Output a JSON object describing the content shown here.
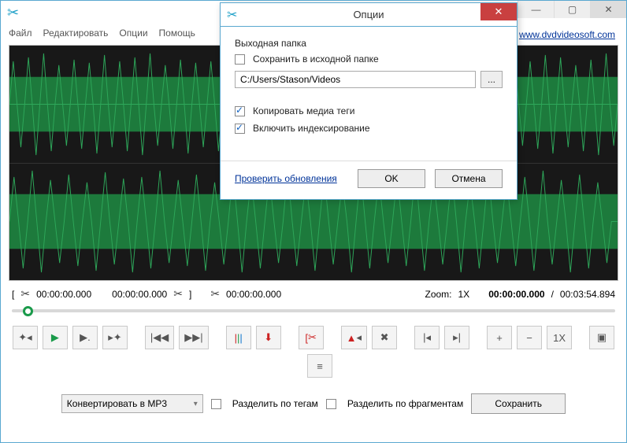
{
  "menubar": {
    "file": "Файл",
    "edit": "Редактировать",
    "options": "Опции",
    "help": "Помощь"
  },
  "site_link": "www.dvdvideosoft.com",
  "time": {
    "sel_start": "00:00:00.000",
    "sel_end": "00:00:00.000",
    "cut_time": "00:00:00.000",
    "zoom_label": "Zoom:",
    "zoom_value": "1X",
    "pos": "00:00:00.000",
    "dur": "00:03:54.894"
  },
  "toolbar": {
    "zoom_reset": "1X"
  },
  "bottom": {
    "convert_label": "Конвертировать в MP3",
    "split_tags": "Разделить по тегам",
    "split_frag": "Разделить по фрагментам",
    "save": "Сохранить"
  },
  "modal": {
    "title": "Опции",
    "section": "Выходная папка",
    "save_in_src": "Сохранить в исходной папке",
    "path": "C:/Users/Stason/Videos",
    "browse": "...",
    "copy_tags": "Копировать медиа теги",
    "indexing": "Включить индексирование",
    "check_updates": "Проверить обновления",
    "ok": "OK",
    "cancel": "Отмена"
  }
}
